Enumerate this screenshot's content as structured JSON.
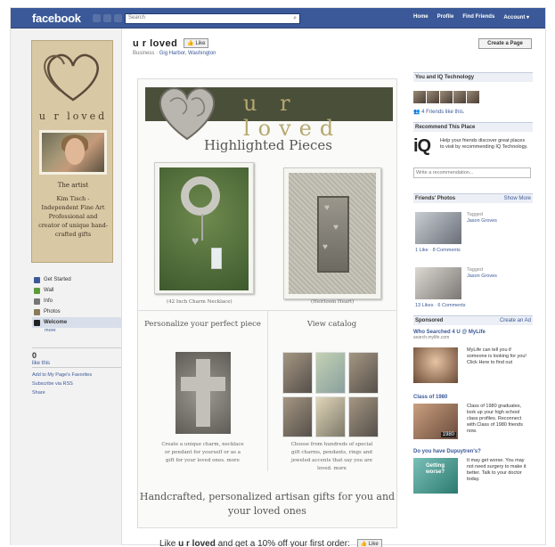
{
  "topbar": {
    "logo": "facebook",
    "search_placeholder": "Search",
    "nav": [
      "Home",
      "Profile",
      "Find Friends",
      "Account ▾"
    ]
  },
  "profile_card": {
    "brand": "u r loved",
    "artist_heading": "The artist",
    "artist_text": "Kim Tisch - Independent Fine Art Professional and creator of unique hand-crafted gifts"
  },
  "leftnav": {
    "items": [
      {
        "label": "Get Started",
        "icon": "flag-icon",
        "color": "#3b5998"
      },
      {
        "label": "Wall",
        "icon": "wall-icon",
        "color": "#5b9c3a"
      },
      {
        "label": "Info",
        "icon": "info-icon",
        "color": "#777777"
      },
      {
        "label": "Photos",
        "icon": "photos-icon",
        "color": "#8a7a58"
      },
      {
        "label": "Welcome",
        "icon": "iq-icon",
        "color": "#222222"
      }
    ],
    "more": "more",
    "likes_count": "0",
    "likes_label": "like this",
    "links": [
      "Add to My Page's Favorites",
      "Subscribe via RSS",
      "Share"
    ]
  },
  "page": {
    "title": "u r loved",
    "like_button": "Like",
    "category": "Business · ",
    "location": "Gig Harbor, Washington",
    "create_page": "Create a Page"
  },
  "canvas": {
    "banner": "u r loved",
    "highlighted": "Highlighted Pieces",
    "caption1": "(42 Inch Charm Necklace)",
    "caption2": "(Heirloom Heart)",
    "personalize_title": "Personalize your perfect piece",
    "personalize_text": "Create a unique charm, necklace or pendant for yourself or as a gift for your loved ones. more",
    "catalog_title": "View catalog",
    "catalog_text": "Choose from hundreds of special gift charms, pendants, rings and jeweled accents that say you are loved. more",
    "tagline": "Handcrafted, personalized artisan gifts for you and your loved ones"
  },
  "cta": {
    "before": "Like ",
    "brand": "u r loved",
    "after": " and get a 10% off your first order:",
    "button": "Like"
  },
  "right": {
    "you_and": "You and IQ Technology",
    "friends_like": "4 Friends like this.",
    "recommend_h": "Recommend This Place",
    "recommend_text": "Help your friends discover great places to visit by recommending IQ Technology.",
    "recommend_placeholder": "Write a recommendation...",
    "friends_photos_h": "Friends' Photos",
    "show_more": "Show More",
    "photo1": {
      "tagged": "Tagged",
      "name": "Jason Groves",
      "stats": "1 Like · 8 Comments"
    },
    "photo2": {
      "tagged": "Tagged",
      "name": "Jason Groves",
      "stats": "13 Likes · 6 Comments"
    },
    "sponsored_h": "Sponsored",
    "create_ad": "Create an Ad",
    "ads": [
      {
        "title": "Who Searched 4 U @ MyLife",
        "url": "search.mylife.com",
        "text": "MyLife can tell you if someone is looking for you! Click Here to find out"
      },
      {
        "title": "Class of 1980",
        "url": "",
        "text": "Class of 1980 graduates, look up your high school class profiles. Reconnect with Class of 1980 friends now.",
        "badge": "1980"
      },
      {
        "title": "Do you have Dupuytren's?",
        "url": "",
        "text": "It may get worse. You may not need surgery to make it better. Talk to your doctor today.",
        "badge": "Getting worse?"
      }
    ]
  }
}
